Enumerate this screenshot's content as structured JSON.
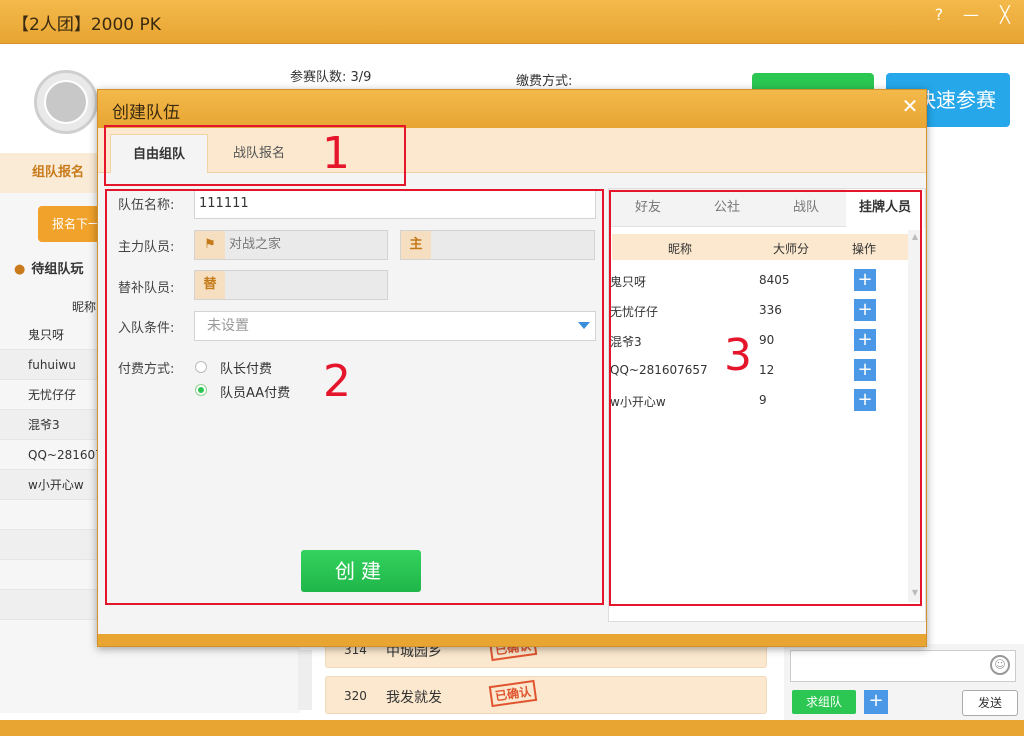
{
  "window": {
    "title": "【2人团】2000 PK",
    "help": "?",
    "minimize": "—",
    "close": "╳"
  },
  "header": {
    "team_count": "参赛队数: 3/9",
    "fee_mode": "缴费方式:",
    "quick_join": "快速参赛"
  },
  "left": {
    "tab": "组队报名",
    "report_btn": "报名下一",
    "waiting": "待组队玩",
    "nick_header": "昵称",
    "players": [
      "鬼只呀",
      "fuhuiwu",
      "无忧仔仔",
      "混爷3",
      "QQ~281607657",
      "w小开心w"
    ]
  },
  "confirmed": [
    {
      "num": "314",
      "name": "中城园乡",
      "stamp": "已确认"
    },
    {
      "num": "320",
      "name": "我发就发",
      "stamp": "已确认"
    }
  ],
  "chat": {
    "seek_team": "求组队",
    "plus": "+",
    "send": "发送",
    "smile": "☺"
  },
  "dialog": {
    "title": "创建队伍",
    "close": "✕",
    "tabs": [
      "自由组队",
      "战队报名"
    ],
    "team_name_label": "队伍名称:",
    "team_name_value": "111111",
    "main_members_label": "主力队员:",
    "main_member_1": "对战之家",
    "main_tag": "主",
    "sub_members_label": "替补队员:",
    "sub_tag": "替",
    "condition_label": "入队条件:",
    "condition_value": "未设置",
    "payment_label": "付费方式:",
    "payment_options": [
      "队长付费",
      "队员AA付费"
    ],
    "payment_selected": "队员AA付费",
    "create_btn": "创建",
    "right_tabs": [
      "好友",
      "公社",
      "战队",
      "挂牌人员"
    ],
    "right_active_tab": "挂牌人员",
    "table_headers": [
      "昵称",
      "大师分",
      "操作"
    ],
    "rows": [
      {
        "nick": "鬼只呀",
        "score": "8405"
      },
      {
        "nick": "无忧仔仔",
        "score": "336"
      },
      {
        "nick": "混爷3",
        "score": "90"
      },
      {
        "nick": "QQ~281607657",
        "score": "12"
      },
      {
        "nick": "w小开心w",
        "score": "9"
      }
    ],
    "row_action": "+"
  },
  "annotations": [
    "1",
    "2",
    "3"
  ],
  "colors": {
    "orange": "#e8a532",
    "green": "#2cc652",
    "blue": "#25a7ea",
    "annotation_red": "#e5152b"
  }
}
